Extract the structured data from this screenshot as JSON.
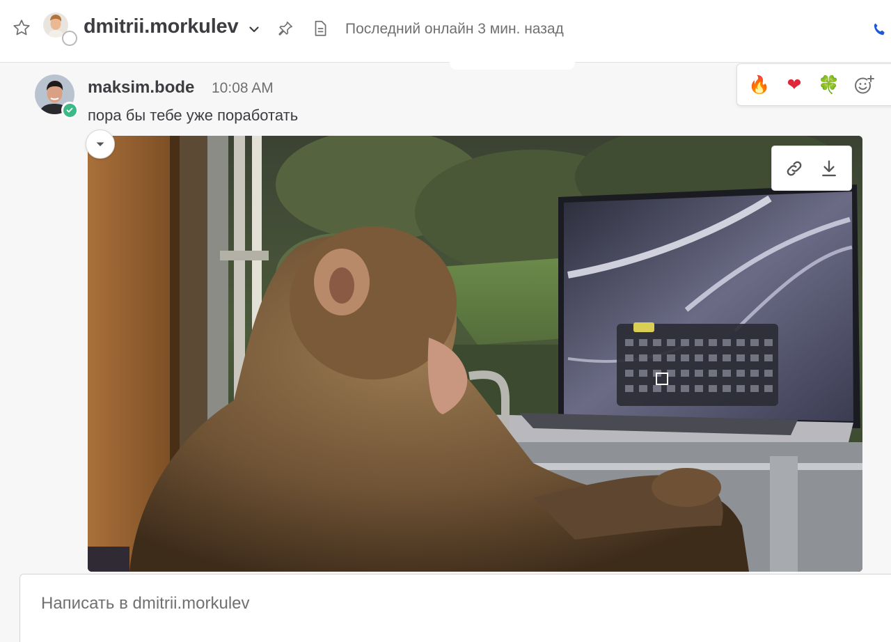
{
  "header": {
    "channel_name": "dmitrii.morkulev",
    "status_text": "Последний онлайн 3 мин. назад",
    "icons": {
      "favorite": "star-icon",
      "expand": "chevron-down-icon",
      "pin": "pin-icon",
      "files": "document-icon",
      "call": "phone-icon"
    },
    "accent_color": "#1c58d9"
  },
  "message": {
    "sender": "maksim.bode",
    "time": "10:08 AM",
    "text": "пора бы тебе уже поработать",
    "sender_status": "online",
    "online_color": "#3db887",
    "attachment": {
      "type": "image",
      "subject": "monkey-at-laptop-photo",
      "actions": [
        "link-icon",
        "download-icon"
      ]
    }
  },
  "reactions": [
    {
      "name": "fire",
      "glyph": "🔥"
    },
    {
      "name": "heart",
      "glyph": "❤"
    },
    {
      "name": "four-leaf-clover",
      "glyph": "🍀"
    },
    {
      "name": "add-reaction",
      "glyph": ""
    }
  ],
  "composer": {
    "placeholder": "Написать в dmitrii.morkulev"
  }
}
